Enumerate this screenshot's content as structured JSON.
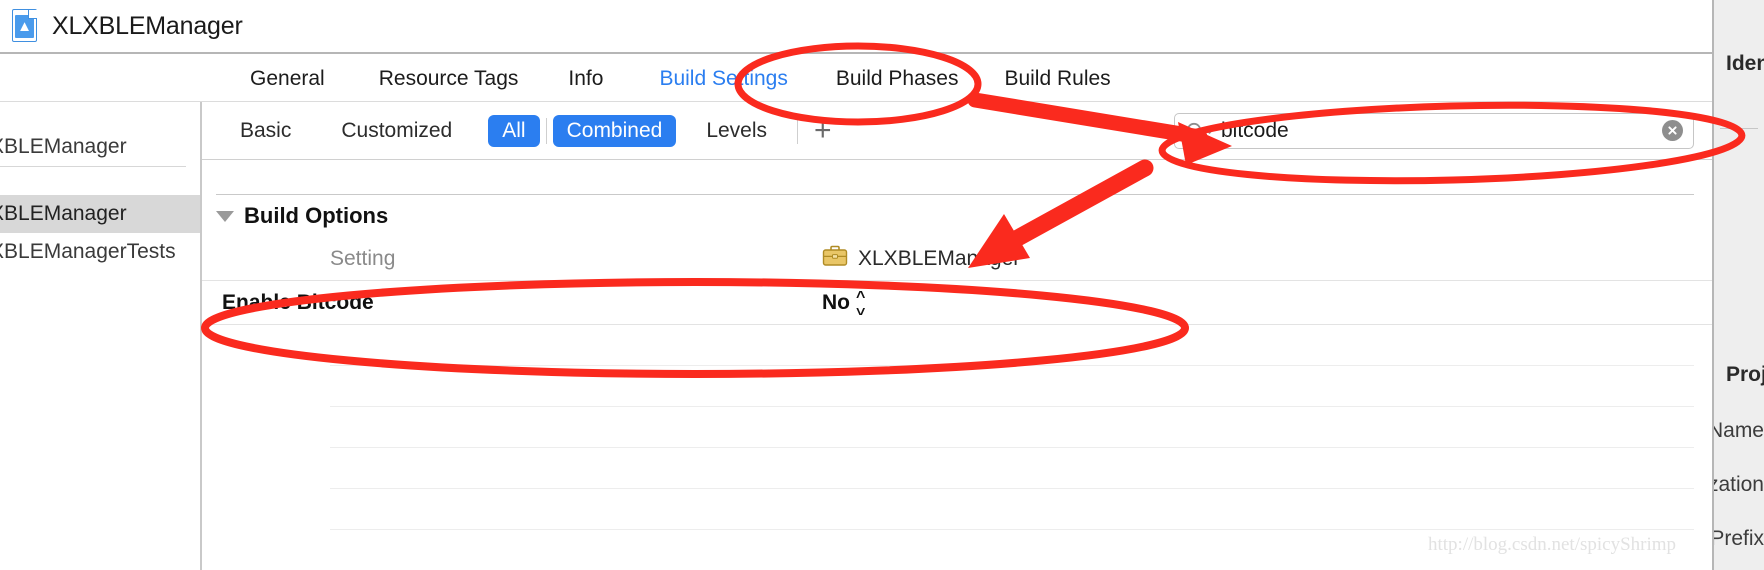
{
  "window": {
    "title": "XLXBLEManager",
    "project_icon": "xcode-project-icon"
  },
  "tabs": [
    {
      "label": "General",
      "selected": false
    },
    {
      "label": "Resource Tags",
      "selected": false
    },
    {
      "label": "Info",
      "selected": false
    },
    {
      "label": "Build Settings",
      "selected": true
    },
    {
      "label": "Build Phases",
      "selected": false
    },
    {
      "label": "Build Rules",
      "selected": false
    }
  ],
  "sidebar": {
    "items": [
      {
        "label": "XBLEManager",
        "selected": false
      },
      {
        "label": "XBLEManager",
        "selected": true
      },
      {
        "label": "XBLEManagerTests",
        "selected": false
      }
    ]
  },
  "filterbar": {
    "segments": [
      {
        "label": "Basic",
        "active": false
      },
      {
        "label": "Customized",
        "active": false
      },
      {
        "label": "All",
        "active": true
      },
      {
        "label": "Combined",
        "active": true
      },
      {
        "label": "Levels",
        "active": false
      }
    ],
    "add_label": "+",
    "add_icon": "plus-icon"
  },
  "search": {
    "icon": "search-icon",
    "value": "bitcode",
    "placeholder": "",
    "clear_icon": "clear-circle-icon"
  },
  "settings": {
    "group": {
      "title": "Build Options",
      "expanded": true,
      "disclosure_icon": "triangle-down-icon"
    },
    "columns": {
      "setting": "Setting",
      "target": "XLXBLEManager",
      "target_icon": "briefcase-icon"
    },
    "rows": [
      {
        "name": "Enable Bitcode",
        "value": "No",
        "control": "stepper-icon"
      }
    ],
    "empty_row_count": 5
  },
  "inspector": {
    "identity_header": "Identity",
    "project_header": "Project",
    "fields": [
      {
        "label": "Project Name"
      },
      {
        "label": "Organization"
      },
      {
        "label": "Class Prefix"
      }
    ]
  },
  "annotations": {
    "color": "#FA2A1E",
    "ellipse_build_settings": "build-settings-tab-highlight",
    "ellipse_search": "search-field-highlight",
    "ellipse_enable_bitcode": "enable-bitcode-row-highlight",
    "arrow_to_search": "arrow-build-settings-to-search",
    "arrow_to_row": "arrow-search-to-enable-bitcode"
  },
  "watermark": {
    "text": "http://blog.csdn.net/spicyShrimp"
  }
}
